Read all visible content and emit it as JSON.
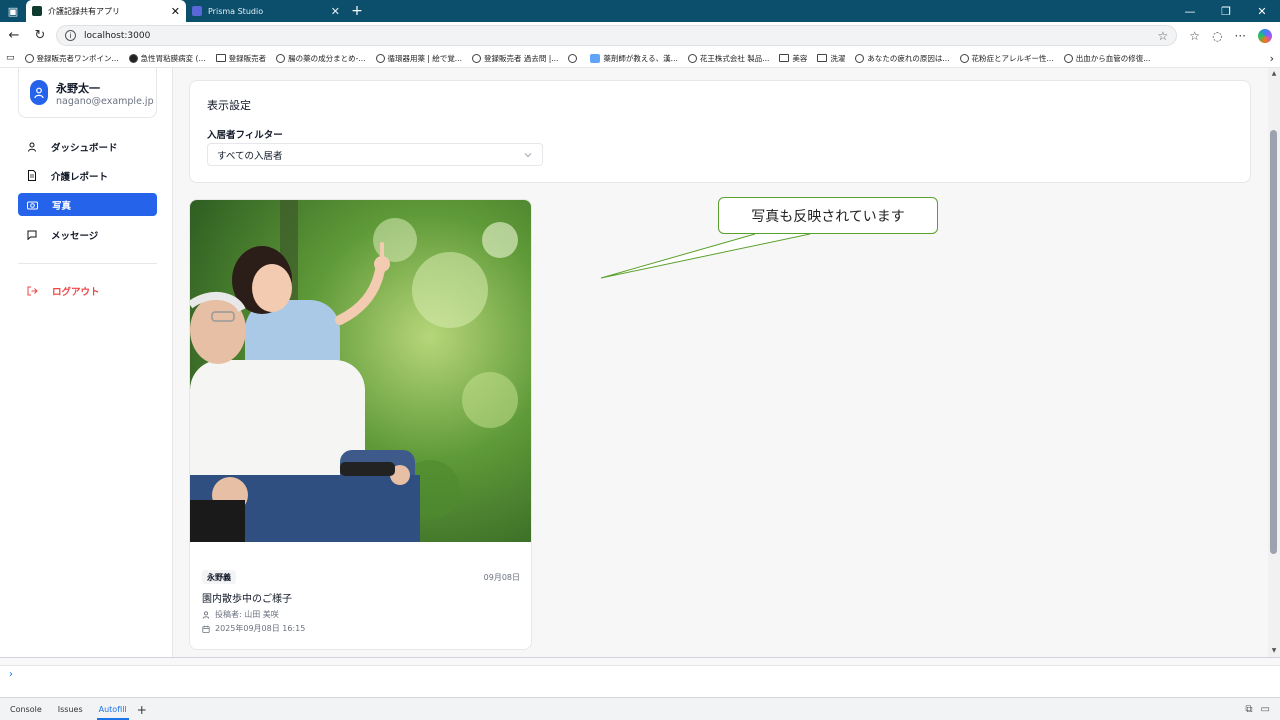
{
  "browser": {
    "tabs": [
      {
        "title": "介護記録共有アプリ",
        "active": true
      },
      {
        "title": "Prisma Studio",
        "active": false
      }
    ],
    "url": "localhost:3000",
    "bookmarks": [
      {
        "label": "登録販売者ワンポイン...",
        "icon": "globe-icon"
      },
      {
        "label": "急性胃粘膜病変 (...",
        "icon": "page-icon"
      },
      {
        "label": "登録販売者",
        "icon": "folder-icon"
      },
      {
        "label": "腸の薬の成分まとめ-...",
        "icon": "globe-icon"
      },
      {
        "label": "循環器用薬 | 絵で覚...",
        "icon": "globe-icon"
      },
      {
        "label": "登録販売者 過去問 |...",
        "icon": "globe-icon"
      },
      {
        "label": "",
        "icon": "globe-icon"
      },
      {
        "label": "薬剤師が教える、漢...",
        "icon": "site-icon"
      },
      {
        "label": "花王株式会社 製品...",
        "icon": "globe-icon"
      },
      {
        "label": "美容",
        "icon": "folder-icon"
      },
      {
        "label": "洗濯",
        "icon": "folder-icon"
      },
      {
        "label": "あなたの疲れの原因は...",
        "icon": "globe-icon"
      },
      {
        "label": "花粉症とアレルギー性...",
        "icon": "globe-icon"
      },
      {
        "label": "出血から血管の修復...",
        "icon": "globe-icon"
      }
    ]
  },
  "sidebar": {
    "user": {
      "name": "永野太一",
      "email": "nagano@example.jp"
    },
    "items": [
      {
        "label": "ダッシュボード",
        "icon": "user-icon"
      },
      {
        "label": "介護レポート",
        "icon": "document-icon"
      },
      {
        "label": "写真",
        "icon": "camera-icon",
        "active": true
      },
      {
        "label": "メッセージ",
        "icon": "message-icon"
      }
    ],
    "logout": {
      "label": "ログアウト",
      "icon": "logout-icon"
    }
  },
  "display_settings": {
    "title": "表示設定",
    "filter_label": "入居者フィルター",
    "filter_value": "すべての入居者"
  },
  "photo_card": {
    "resident": "永野義",
    "date": "09月08日",
    "title": "園内散歩中のご様子",
    "poster": "投稿者: 山田 美咲",
    "timestamp": "2025年09月08日 16:15"
  },
  "callout": {
    "text": "写真も反映されています"
  },
  "devtools": {
    "tabs": [
      {
        "label": "Console",
        "active": false
      },
      {
        "label": "Issues",
        "active": false
      },
      {
        "label": "Autofill",
        "active": true
      }
    ],
    "prompt": "›"
  }
}
